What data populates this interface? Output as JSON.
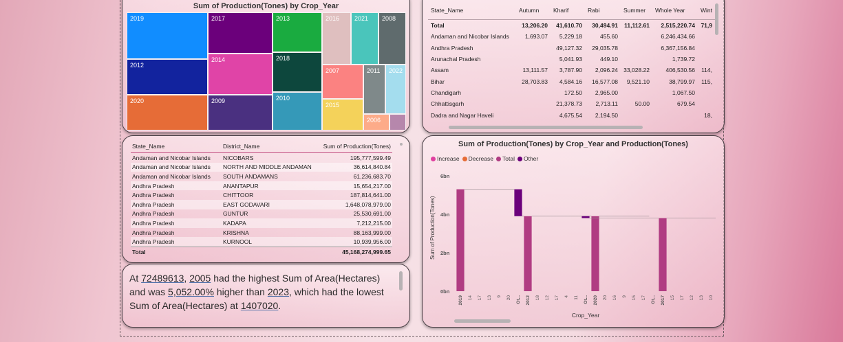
{
  "treemap": {
    "title": "Sum of Production(Tones) by Crop_Year",
    "tiles": [
      {
        "label": "2019",
        "color": "#118dff"
      },
      {
        "label": "2012",
        "color": "#12239e"
      },
      {
        "label": "2020",
        "color": "#e66c37"
      },
      {
        "label": "2017",
        "color": "#6b007b"
      },
      {
        "label": "2014",
        "color": "#e044a7"
      },
      {
        "label": "2009",
        "color": "#4a3080"
      },
      {
        "label": "2013",
        "color": "#1aab40"
      },
      {
        "label": "2018",
        "color": "#0d473d"
      },
      {
        "label": "2010",
        "color": "#3599b8"
      },
      {
        "label": "2016",
        "color": "#dfbfbf"
      },
      {
        "label": "2021",
        "color": "#4ac5bb"
      },
      {
        "label": "2008",
        "color": "#5f6b6d"
      },
      {
        "label": "2007",
        "color": "#fb8281"
      },
      {
        "label": "2011",
        "color": "#7f898a"
      },
      {
        "label": "2022",
        "color": "#a4ddee"
      },
      {
        "label": "2015",
        "color": "#f4d25a"
      },
      {
        "label": "2006",
        "color": "#fdab89"
      },
      {
        "label": "",
        "color": "#b687ac"
      }
    ]
  },
  "matrix": {
    "columns": [
      "State_Name",
      "Autumn",
      "Kharif",
      "Rabi",
      "Summer",
      "Whole Year",
      "Wint"
    ],
    "rows": [
      {
        "name": "Total",
        "autumn": "13,206.20",
        "kharif": "41,610.70",
        "rabi": "30,494.91",
        "summer": "11,112.61",
        "whole": "2,515,220.74",
        "winter": "71,9"
      },
      {
        "name": "Andaman and Nicobar Islands",
        "autumn": "1,693.07",
        "kharif": "5,229.18",
        "rabi": "455.60",
        "summer": "",
        "whole": "6,246,434.66",
        "winter": ""
      },
      {
        "name": "Andhra Pradesh",
        "autumn": "",
        "kharif": "49,127.32",
        "rabi": "29,035.78",
        "summer": "",
        "whole": "6,367,156.84",
        "winter": ""
      },
      {
        "name": "Arunachal Pradesh",
        "autumn": "",
        "kharif": "5,041.93",
        "rabi": "449.10",
        "summer": "",
        "whole": "1,739.72",
        "winter": ""
      },
      {
        "name": "Assam",
        "autumn": "13,111.57",
        "kharif": "3,787.90",
        "rabi": "2,096.24",
        "summer": "33,028.22",
        "whole": "406,530.56",
        "winter": "114,"
      },
      {
        "name": "Bihar",
        "autumn": "28,703.83",
        "kharif": "4,584.16",
        "rabi": "16,577.08",
        "summer": "9,521.10",
        "whole": "38,799.97",
        "winter": "115,"
      },
      {
        "name": "Chandigarh",
        "autumn": "",
        "kharif": "172.50",
        "rabi": "2,965.00",
        "summer": "",
        "whole": "1,067.50",
        "winter": ""
      },
      {
        "name": "Chhattisgarh",
        "autumn": "",
        "kharif": "21,378.73",
        "rabi": "2,713.11",
        "summer": "50.00",
        "whole": "679.54",
        "winter": ""
      },
      {
        "name": "Dadra and Nagar Haveli",
        "autumn": "",
        "kharif": "4,675.54",
        "rabi": "2,194.50",
        "summer": "",
        "whole": "",
        "winter": "18,"
      }
    ]
  },
  "detail": {
    "columns": [
      "State_Name",
      "District_Name",
      "Sum of Production(Tones)"
    ],
    "rows": [
      {
        "state": "Andaman and Nicobar Islands",
        "district": "NICOBARS",
        "value": "195,777,599.49"
      },
      {
        "state": "Andaman and Nicobar Islands",
        "district": "NORTH AND MIDDLE ANDAMAN",
        "value": "36,614,840.84"
      },
      {
        "state": "Andaman and Nicobar Islands",
        "district": "SOUTH ANDAMANS",
        "value": "61,236,683.70"
      },
      {
        "state": "Andhra Pradesh",
        "district": "ANANTAPUR",
        "value": "15,654,217.00"
      },
      {
        "state": "Andhra Pradesh",
        "district": "CHITTOOR",
        "value": "187,814,641.00"
      },
      {
        "state": "Andhra Pradesh",
        "district": "EAST GODAVARI",
        "value": "1,648,078,979.00"
      },
      {
        "state": "Andhra Pradesh",
        "district": "GUNTUR",
        "value": "25,530,691.00"
      },
      {
        "state": "Andhra Pradesh",
        "district": "KADAPA",
        "value": "7,212,215.00"
      },
      {
        "state": "Andhra Pradesh",
        "district": "KRISHNA",
        "value": "88,163,999.00"
      },
      {
        "state": "Andhra Pradesh",
        "district": "KURNOOL",
        "value": "10,939,956.00"
      }
    ],
    "total_label": "Total",
    "total_value": "45,168,274,999.65"
  },
  "narrative": {
    "p1": "At ",
    "v1": "72489613",
    "p2": ", ",
    "v2": "2005",
    "p3": " had the highest Sum of Area(Hectares) and was ",
    "v3": "5,052.00%",
    "p4": " higher than ",
    "v4": "2023",
    "p5": ", which had the lowest Sum of Area(Hectares) at ",
    "v5": "1407020",
    "p6": "."
  },
  "waterfall": {
    "title": "Sum of Production(Tones) by Crop_Year and Production(Tones)",
    "legend": [
      {
        "label": "Increase",
        "color": "#e040a0"
      },
      {
        "label": "Decrease",
        "color": "#e66c37"
      },
      {
        "label": "Total",
        "color": "#b03c82"
      },
      {
        "label": "Other",
        "color": "#6b007b"
      }
    ],
    "yaxis_title": "Sum of Production(Tones)",
    "xaxis_title": "Crop_Year",
    "yticks": [
      "0bn",
      "2bn",
      "4bn",
      "6bn"
    ],
    "xticks": [
      "2019",
      "14",
      "17",
      "13",
      "9",
      "20",
      "Ot...",
      "2012",
      "18",
      "12",
      "17",
      "4",
      "11",
      "Ot...",
      "2020",
      "20",
      "16",
      "9",
      "15",
      "17",
      "Ot...",
      "2017",
      "15",
      "17",
      "12",
      "13",
      "10"
    ]
  },
  "chart_data": {
    "type": "bar",
    "title": "Sum of Production(Tones) by Crop_Year and Production(Tones)",
    "xlabel": "Crop_Year",
    "ylabel": "Sum of Production(Tones)",
    "ylim": [
      0,
      6.5
    ],
    "y_unit": "bn",
    "legend": [
      "Increase",
      "Decrease",
      "Total",
      "Other"
    ],
    "categories": [
      "2019",
      "14",
      "17",
      "13",
      "9",
      "20",
      "Ot...",
      "2012",
      "18",
      "12",
      "17",
      "4",
      "11",
      "Ot...",
      "2020",
      "20",
      "16",
      "9",
      "15",
      "17",
      "Ot...",
      "2017",
      "15",
      "17",
      "12",
      "13",
      "10"
    ],
    "bars": [
      {
        "category": "2019",
        "kind": "Total",
        "start": 0,
        "end": 5.3
      },
      {
        "category": "Ot...",
        "kind": "Other",
        "start": 5.3,
        "end": 3.9
      },
      {
        "category": "2012",
        "kind": "Total",
        "start": 0,
        "end": 3.9
      },
      {
        "category": "2020",
        "kind": "Total",
        "start": 0,
        "end": 3.9
      },
      {
        "category": "Ot...",
        "kind": "Other",
        "start": 3.9,
        "end": 3.8
      },
      {
        "category": "2017",
        "kind": "Total",
        "start": 0,
        "end": 3.8
      }
    ]
  }
}
